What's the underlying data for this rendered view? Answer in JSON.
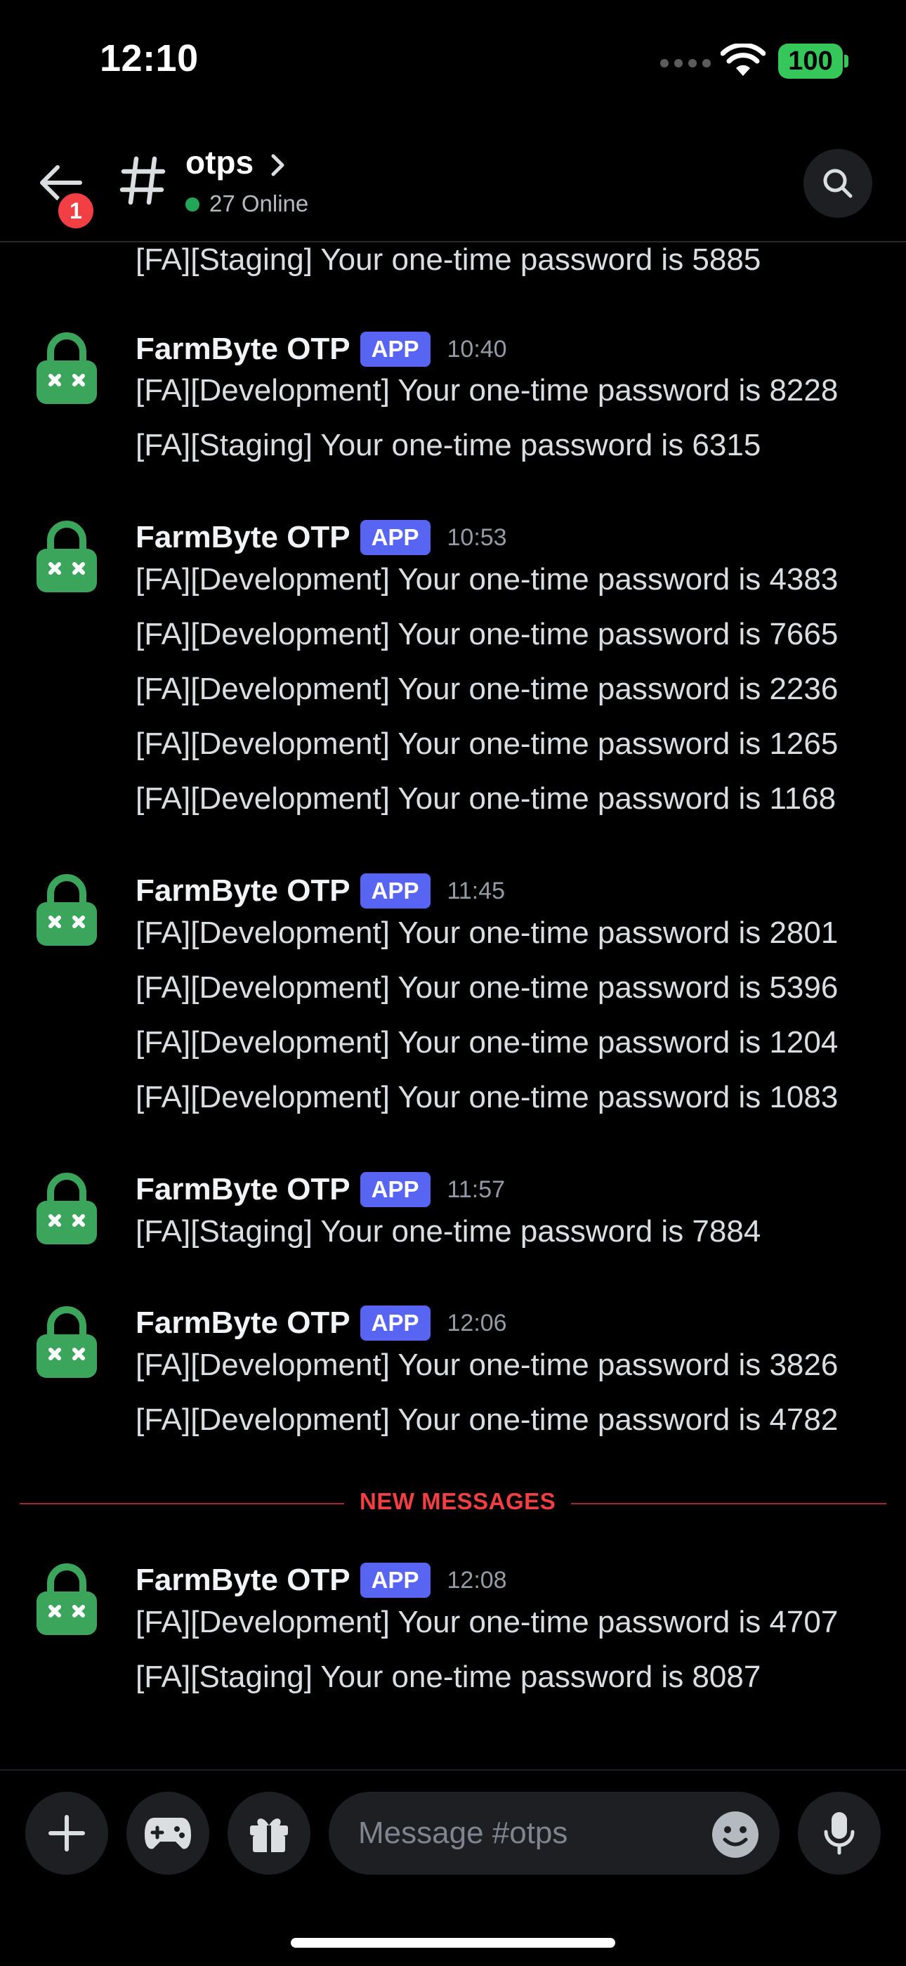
{
  "status": {
    "time": "12:10",
    "battery": "100"
  },
  "header": {
    "channel": "otps",
    "online": "27 Online",
    "back_badge": "1"
  },
  "chat": {
    "top_partial": "[FA][Staging] Your one-time password is 5885",
    "groups": [
      {
        "author": "FarmByte OTP",
        "tag": "APP",
        "time": "10:40",
        "lines": [
          "[FA][Development] Your one-time password is 8228",
          "[FA][Staging] Your one-time password is 6315"
        ]
      },
      {
        "author": "FarmByte OTP",
        "tag": "APP",
        "time": "10:53",
        "lines": [
          "[FA][Development] Your one-time password is 4383",
          "[FA][Development] Your one-time password is 7665",
          "[FA][Development] Your one-time password is 2236",
          "[FA][Development] Your one-time password is 1265",
          "[FA][Development] Your one-time password is 1168"
        ]
      },
      {
        "author": "FarmByte OTP",
        "tag": "APP",
        "time": "11:45",
        "lines": [
          "[FA][Development] Your one-time password is 2801",
          "[FA][Development] Your one-time password is 5396",
          "[FA][Development] Your one-time password is 1204",
          "[FA][Development] Your one-time password is 1083"
        ]
      },
      {
        "author": "FarmByte OTP",
        "tag": "APP",
        "time": "11:57",
        "lines": [
          "[FA][Staging] Your one-time password is 7884"
        ]
      },
      {
        "author": "FarmByte OTP",
        "tag": "APP",
        "time": "12:06",
        "lines": [
          "[FA][Development] Your one-time password is 3826",
          "[FA][Development] Your one-time password is 4782"
        ]
      },
      {
        "author": "FarmByte OTP",
        "tag": "APP",
        "time": "12:08",
        "lines": [
          "[FA][Development] Your one-time password is 4707",
          "[FA][Staging] Your one-time password is 8087"
        ]
      }
    ],
    "new_messages_label": "NEW MESSAGES"
  },
  "composer": {
    "placeholder": "Message #otps"
  },
  "colors": {
    "accent": "#5865f2",
    "online": "#23a55a",
    "danger": "#f23f43",
    "avatar": "#3ba55c"
  },
  "icons": [
    "back-arrow-icon",
    "hash-icon",
    "chevron-right-icon",
    "search-icon",
    "lock-avatar-icon",
    "plus-icon",
    "gamepad-icon",
    "gift-icon",
    "emoji-icon",
    "microphone-icon",
    "wifi-icon"
  ]
}
